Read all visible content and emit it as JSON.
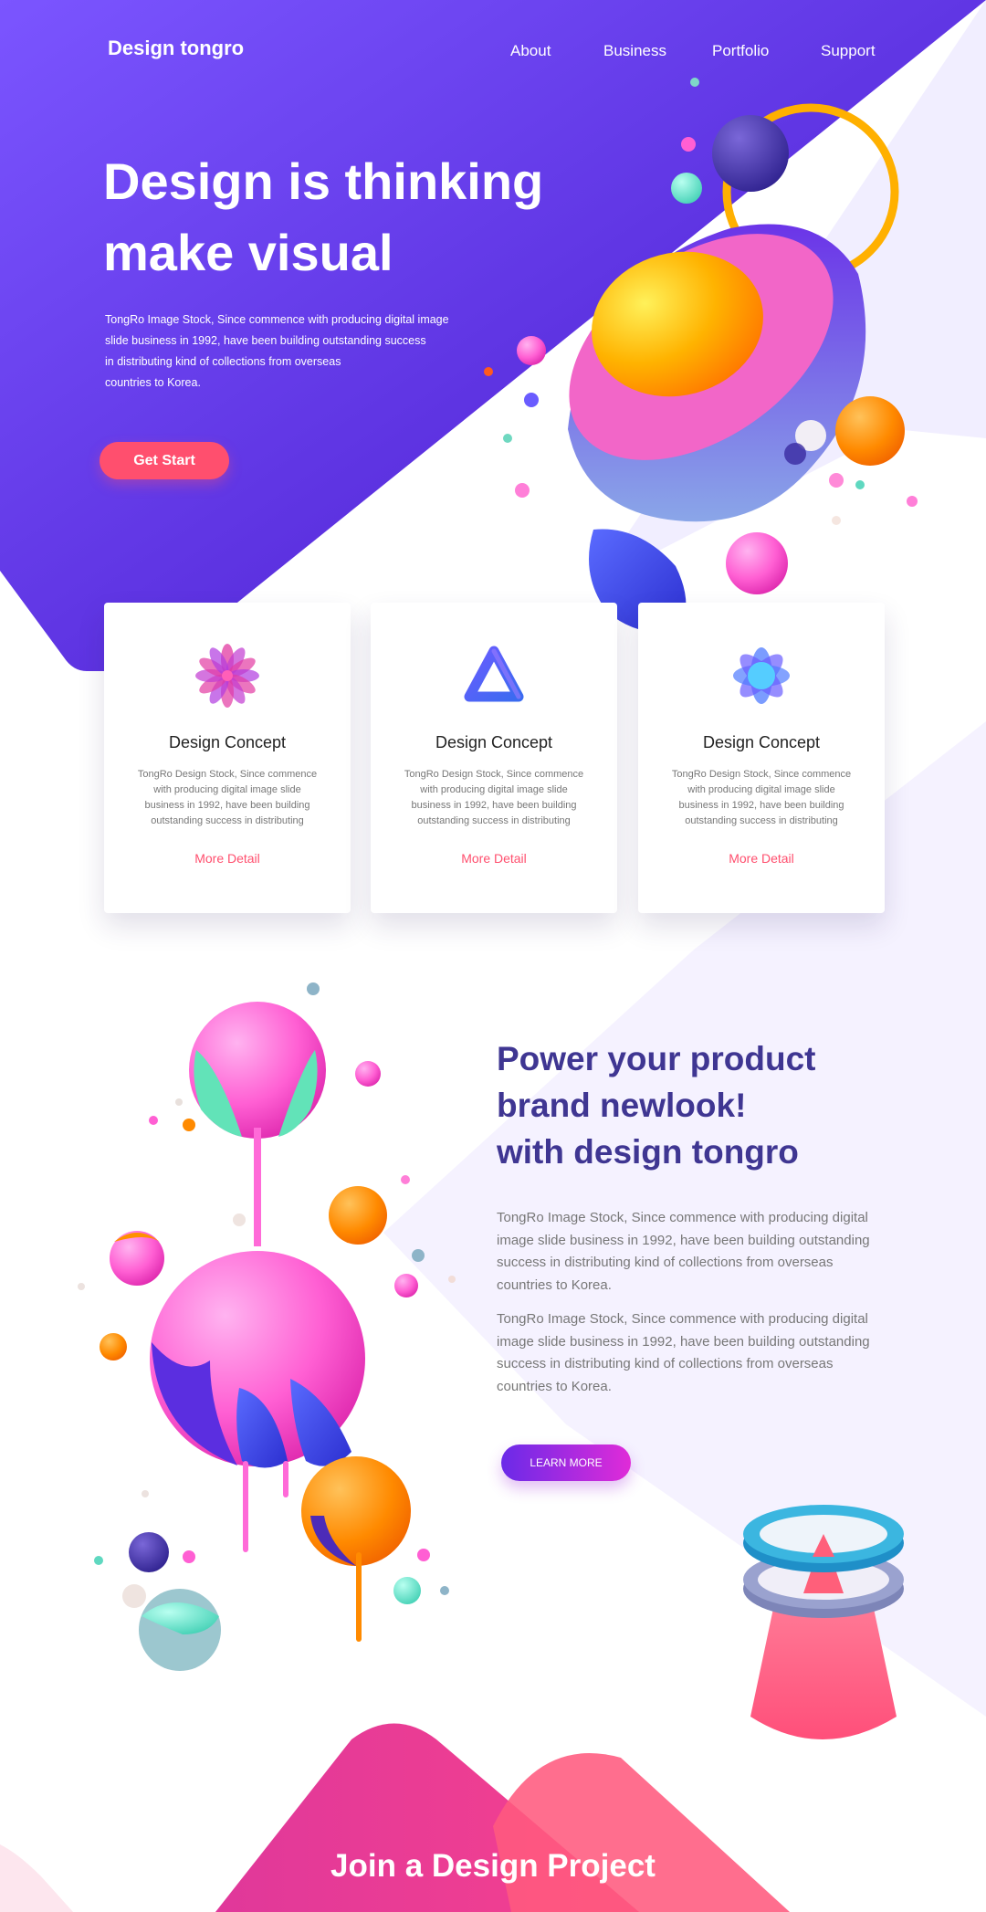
{
  "header": {
    "logo": "Design tongro",
    "nav": [
      "About",
      "Business",
      "Portfolio",
      "Support"
    ]
  },
  "hero": {
    "title_lines": [
      "Design is thinking",
      "make visual"
    ],
    "description_lines": [
      "TongRo Image Stock, Since commence with producing digital image",
      "slide business in 1992, have been building outstanding success",
      "in distributing kind of collections from overseas",
      "countries to Korea."
    ],
    "cta": "Get Start"
  },
  "cards": [
    {
      "icon": "flower-icon",
      "title": "Design Concept",
      "text_lines": [
        "TongRo Design Stock, Since commence",
        "with producing digital image slide",
        "business in 1992, have been building",
        "outstanding success in distributing"
      ],
      "link": "More Detail"
    },
    {
      "icon": "triangle-icon",
      "title": "Design Concept",
      "text_lines": [
        "TongRo Design Stock, Since commence",
        "with producing digital image slide",
        "business in 1992, have been building",
        "outstanding success in distributing"
      ],
      "link": "More Detail"
    },
    {
      "icon": "star-icon",
      "title": "Design Concept",
      "text_lines": [
        "TongRo Design Stock, Since commence",
        "with producing digital image slide",
        "business in 1992, have been building",
        "outstanding success in distributing"
      ],
      "link": "More Detail"
    }
  ],
  "power": {
    "title_lines": [
      "Power your product",
      "brand newlook!",
      "with design tongro"
    ],
    "paragraph1_lines": [
      "TongRo Image Stock, Since commence with producing digital",
      "image slide business in 1992, have been building outstanding",
      "success in distributing kind of collections from overseas",
      "countries to Korea."
    ],
    "paragraph2_lines": [
      "TongRo Image Stock, Since commence with producing digital",
      "image slide business in 1992, have been building outstanding",
      "success in distributing kind of collections from overseas",
      "countries to Korea."
    ],
    "cta": "LEARN MORE"
  },
  "footer": {
    "title": "Join a Design Project"
  },
  "colors": {
    "hero_gradient_start": "#7b55ff",
    "hero_gradient_end": "#4a1fd4",
    "accent_pink": "#ff4f6e",
    "heading_purple": "#3f3692",
    "button_gradient_start": "#6a2ae8",
    "button_gradient_end": "#e02bd8"
  }
}
